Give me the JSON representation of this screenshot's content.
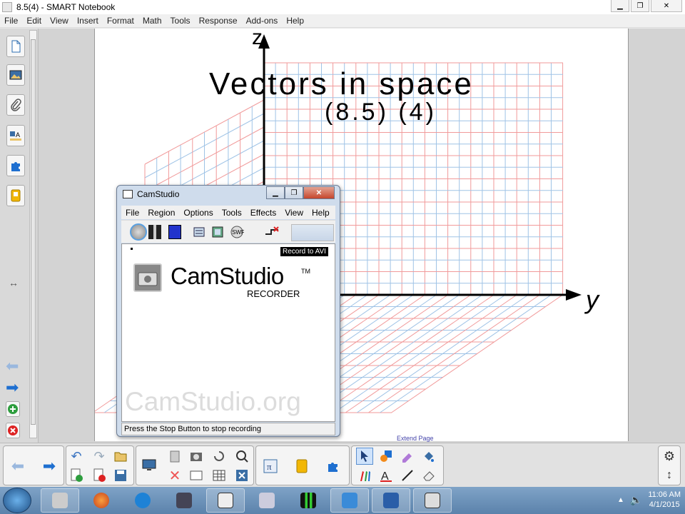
{
  "window": {
    "title": "8.5(4) - SMART Notebook",
    "minimize": "▁",
    "maximize": "❐",
    "close": "✕"
  },
  "menu": [
    "File",
    "Edit",
    "View",
    "Insert",
    "Format",
    "Math",
    "Tools",
    "Response",
    "Add-ons",
    "Help"
  ],
  "page": {
    "title_line1": "Vectors in space",
    "title_line2": "(8.5) (4)",
    "axis_z": "z",
    "axis_y": "y",
    "extend_label": "Extend Page"
  },
  "camstudio": {
    "title": "CamStudio",
    "menu": [
      "File",
      "Region",
      "Options",
      "Tools",
      "Effects",
      "View",
      "Help"
    ],
    "tooltip": "Record to AVI",
    "brand": "CamStudio",
    "trademark": "TM",
    "recorder": "RECORDER",
    "watermark": "CamStudio.org",
    "status": "Press the Stop Button to stop recording",
    "buttons": [
      "record",
      "pause",
      "stop",
      "region",
      "options",
      "swf",
      "autopan"
    ]
  },
  "taskbar": {
    "time": "11:06 AM",
    "date": "4/1/2015",
    "apps": [
      "unknown-app",
      "firefox",
      "internet-explorer",
      "network-app",
      "camera-app",
      "calculator",
      "audio-app",
      "notebook",
      "smart-tools",
      "camstudio"
    ]
  },
  "colors": {
    "grid_red": "#f19a9a",
    "grid_blue": "#9fc3e6",
    "accent_blue": "#1e6fd0"
  }
}
